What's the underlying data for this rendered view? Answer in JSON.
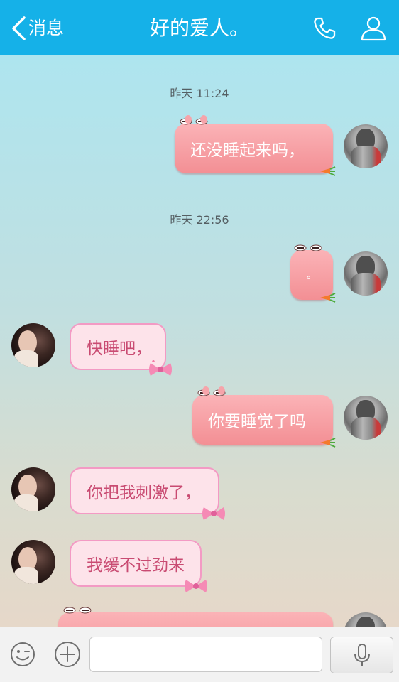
{
  "header": {
    "back_label": "消息",
    "title": "好的爱人。",
    "back_icon": "chevron-left-icon",
    "phone_icon": "phone-icon",
    "contact_icon": "person-icon"
  },
  "colors": {
    "header_bg": "#15b1e8",
    "outgoing_bubble": "#f59ca0",
    "incoming_bubble": "#fde3ea",
    "incoming_text": "#c94b72"
  },
  "chat": {
    "timestamps": [
      "昨天 11:24",
      "昨天 22:56"
    ],
    "messages": [
      {
        "from": "me",
        "text": "还没睡起来吗，"
      },
      {
        "from": "me",
        "text": "。"
      },
      {
        "from": "her",
        "text": "快睡吧，"
      },
      {
        "from": "me",
        "text": "你要睡觉了吗"
      },
      {
        "from": "her",
        "text": "你把我刺激了，"
      },
      {
        "from": "her",
        "text": "我缓不过劲来"
      }
    ]
  },
  "input_bar": {
    "emoji_icon": "emoji-icon",
    "plus_icon": "plus-icon",
    "mic_icon": "microphone-icon",
    "message_placeholder": ""
  }
}
